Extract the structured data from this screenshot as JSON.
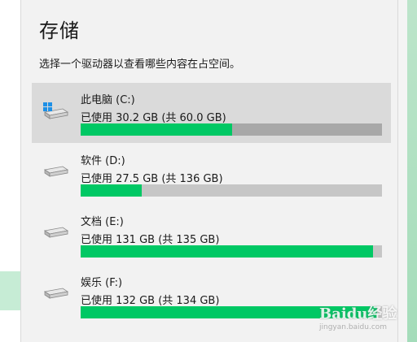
{
  "panel": {
    "title": "存储",
    "description": "选择一个驱动器以查看哪些内容在占空间。"
  },
  "drives": [
    {
      "name": "此电脑 (C:)",
      "usage": "已使用 30.2 GB (共 60.0 GB)",
      "used_fraction": 0.503,
      "icon": "windows-drive-icon",
      "selected": true
    },
    {
      "name": "软件 (D:)",
      "usage": "已使用 27.5 GB (共 136 GB)",
      "used_fraction": 0.202,
      "icon": "drive-icon",
      "selected": false
    },
    {
      "name": "文档 (E:)",
      "usage": "已使用 131 GB (共 135 GB)",
      "used_fraction": 0.97,
      "icon": "drive-icon",
      "selected": false
    },
    {
      "name": "娱乐 (F:)",
      "usage": "已使用 132 GB (共 134 GB)",
      "used_fraction": 0.985,
      "icon": "drive-icon",
      "selected": false
    }
  ],
  "colors": {
    "usage_fill": "#00c864",
    "selected_bg": "#dadada",
    "windows_logo": "#1e90e6"
  },
  "watermark": "Baidu经验",
  "watermark_sub": "jingyan.baidu.com"
}
